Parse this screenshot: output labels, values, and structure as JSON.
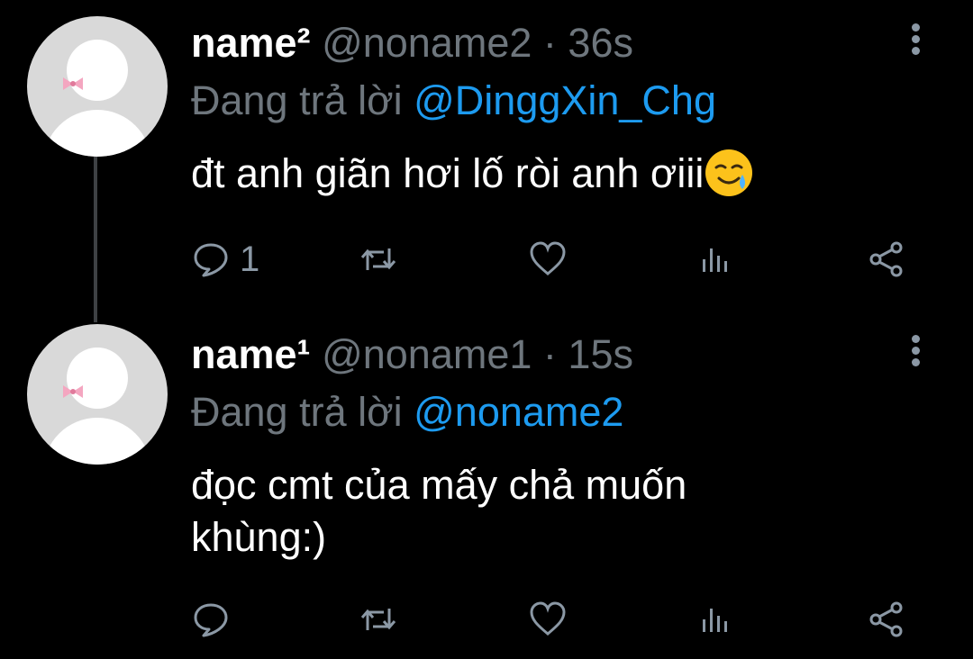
{
  "tweets": [
    {
      "display_name": "name²",
      "handle": "@noname2",
      "separator": "·",
      "time": "36s",
      "reply_prefix": "Đang trả lời ",
      "reply_mention": "@DinggXin_Chg",
      "text": "đt anh giãn hơi lố ròi anh ơiii",
      "emoji": "smiling-face-with-tear",
      "actions": {
        "reply_count": "1"
      }
    },
    {
      "display_name": "name¹",
      "handle": "@noname1",
      "separator": "·",
      "time": "15s",
      "reply_prefix": "Đang trả lời ",
      "reply_mention": "@noname2",
      "text_line1": "đọc cmt của mấy chả muốn",
      "text_line2": "khùng:)",
      "actions": {
        "reply_count": ""
      }
    }
  ],
  "colors": {
    "background": "#000000",
    "text": "#ffffff",
    "muted": "#6e767d",
    "mention": "#1d9bf0",
    "icon": "#8b98a5"
  }
}
